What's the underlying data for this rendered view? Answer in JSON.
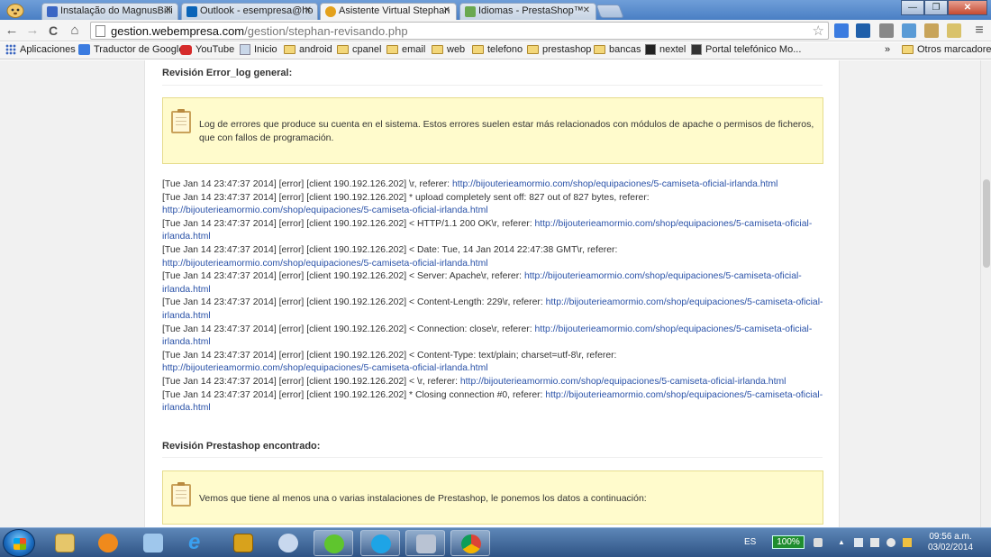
{
  "tabs": [
    {
      "title": "Instalação do MagnusBilli",
      "color": "#3b66c4"
    },
    {
      "title": "Outlook - esempresa@ho",
      "color": "#0a64b8"
    },
    {
      "title": "Asistente Virtual Stephan",
      "color": "#e4a11b"
    },
    {
      "title": "Idiomas - PrestaShop™",
      "color": "#6aa84f"
    }
  ],
  "window": {
    "minimize": "—",
    "maximize": "❐",
    "close": "✕"
  },
  "toolbar": {
    "back": "←",
    "forward": "→",
    "reload": "C",
    "home": "⌂",
    "url_host": "gestion.webempresa.com",
    "url_path": "/gestion/stephan-revisando.php",
    "star": "☆",
    "menu": "≡"
  },
  "bookmarks": {
    "apps": "Aplicaciones",
    "items": [
      "Traductor de Google",
      "YouTube",
      "Inicio",
      "android",
      "cpanel",
      "email",
      "web",
      "telefono",
      "prestashop",
      "bancas",
      "nextel",
      "Portal telefónico Mo..."
    ],
    "more": "»",
    "other": "Otros marcadores"
  },
  "section_error_log": {
    "title": "Revisión Error_log general:",
    "notice": "Log de errores que produce su cuenta en el sistema. Estos errores suelen estar más relacionados con módulos de apache o permisos de ficheros, que con fallos de programación."
  },
  "log_entries": [
    {
      "text": "[Tue Jan 14 23:47:37 2014] [error] [client 190.192.126.202] \\r, referer: ",
      "link": "http://bijouterieamormio.com/shop/equipaciones/5-camiseta-oficial-irlanda.html"
    },
    {
      "text": "[Tue Jan 14 23:47:37 2014] [error] [client 190.192.126.202] * upload completely sent off: 827 out of 827 bytes, referer: ",
      "link": "http://bijouterieamormio.com/shop/equipaciones/5-camiseta-oficial-irlanda.html"
    },
    {
      "text": "[Tue Jan 14 23:47:37 2014] [error] [client 190.192.126.202] < HTTP/1.1 200 OK\\r, referer: ",
      "link": "http://bijouterieamormio.com/shop/equipaciones/5-camiseta-oficial-irlanda.html"
    },
    {
      "text": "[Tue Jan 14 23:47:37 2014] [error] [client 190.192.126.202] < Date: Tue, 14 Jan 2014 22:47:38 GMT\\r, referer: ",
      "link": "http://bijouterieamormio.com/shop/equipaciones/5-camiseta-oficial-irlanda.html"
    },
    {
      "text": "[Tue Jan 14 23:47:37 2014] [error] [client 190.192.126.202] < Server: Apache\\r, referer: ",
      "link": "http://bijouterieamormio.com/shop/equipaciones/5-camiseta-oficial-irlanda.html"
    },
    {
      "text": "[Tue Jan 14 23:47:37 2014] [error] [client 190.192.126.202] < Content-Length: 229\\r, referer: ",
      "link": "http://bijouterieamormio.com/shop/equipaciones/5-camiseta-oficial-irlanda.html"
    },
    {
      "text": "[Tue Jan 14 23:47:37 2014] [error] [client 190.192.126.202] < Connection: close\\r, referer: ",
      "link": "http://bijouterieamormio.com/shop/equipaciones/5-camiseta-oficial-irlanda.html"
    },
    {
      "text": "[Tue Jan 14 23:47:37 2014] [error] [client 190.192.126.202] < Content-Type: text/plain; charset=utf-8\\r, referer: ",
      "link": "http://bijouterieamormio.com/shop/equipaciones/5-camiseta-oficial-irlanda.html"
    },
    {
      "text": "[Tue Jan 14 23:47:37 2014] [error] [client 190.192.126.202] < \\r, referer: ",
      "link": "http://bijouterieamormio.com/shop/equipaciones/5-camiseta-oficial-irlanda.html"
    },
    {
      "text": "[Tue Jan 14 23:47:37 2014] [error] [client 190.192.126.202] * Closing connection #0, referer: ",
      "link": "http://bijouterieamormio.com/shop/equipaciones/5-camiseta-oficial-irlanda.html"
    }
  ],
  "section_prestashop": {
    "title": "Revisión Prestashop encontrado:",
    "notice": "Vemos que tiene al menos una o varias instalaciones de Prestashop, le ponemos los datos a continuación:"
  },
  "taskbar": {
    "language": "ES",
    "battery": "100%",
    "time": "09:56 a.m.",
    "date": "03/02/2014"
  }
}
